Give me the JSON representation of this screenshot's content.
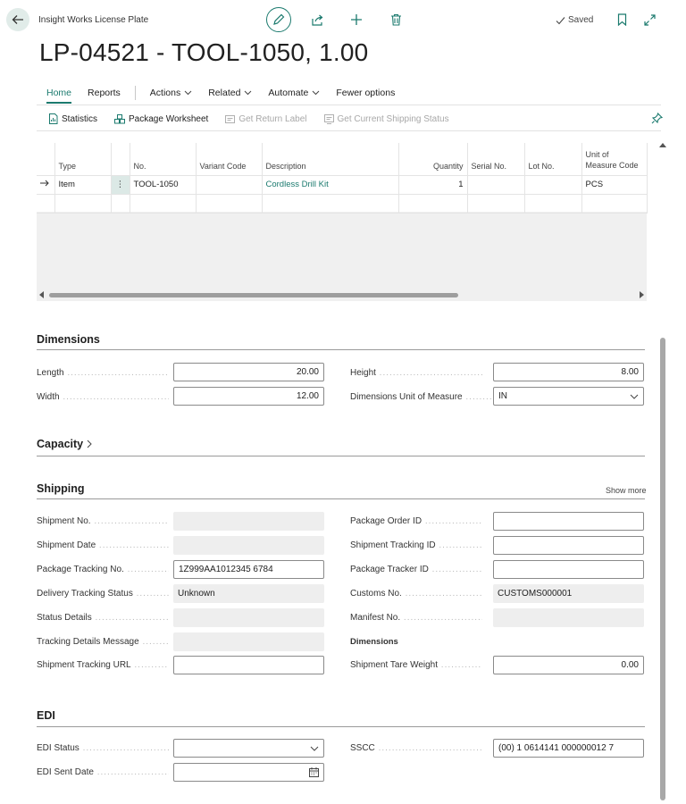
{
  "header": {
    "app_name": "Insight Works License Plate",
    "title": "LP-04521 - TOOL-1050, 1.00",
    "saved": "Saved"
  },
  "nav": {
    "home": "Home",
    "reports": "Reports",
    "actions": "Actions",
    "related": "Related",
    "automate": "Automate",
    "fewer": "Fewer options"
  },
  "toolbar": {
    "statistics": "Statistics",
    "package_worksheet": "Package Worksheet",
    "get_return_label": "Get Return Label",
    "get_shipping_status": "Get Current Shipping Status"
  },
  "lines": {
    "headers": {
      "type": "Type",
      "no": "No.",
      "variant": "Variant Code",
      "description": "Description",
      "quantity": "Quantity",
      "serial": "Serial No.",
      "lot": "Lot No.",
      "uom_1": "Unit of",
      "uom_2": "Measure Code"
    },
    "rows": [
      {
        "type": "Item",
        "no": "TOOL-1050",
        "variant": "",
        "description": "Cordless Drill Kit",
        "quantity": "1",
        "serial": "",
        "lot": "",
        "uom": "PCS"
      }
    ]
  },
  "dimensions": {
    "title": "Dimensions",
    "length_label": "Length",
    "length": "20.00",
    "width_label": "Width",
    "width": "12.00",
    "height_label": "Height",
    "height": "8.00",
    "uom_label": "Dimensions Unit of Measure",
    "uom": "IN"
  },
  "capacity": {
    "title": "Capacity"
  },
  "shipping": {
    "title": "Shipping",
    "show_more": "Show more",
    "shipment_no_label": "Shipment No.",
    "shipment_no": "",
    "shipment_date_label": "Shipment Date",
    "shipment_date": "",
    "package_tracking_label": "Package Tracking No.",
    "package_tracking": "1Z999AA1012345 6784",
    "delivery_status_label": "Delivery Tracking Status",
    "delivery_status": "Unknown",
    "status_details_label": "Status Details",
    "status_details": "",
    "tracking_msg_label": "Tracking Details Message",
    "tracking_msg": "",
    "tracking_url_label": "Shipment Tracking URL",
    "tracking_url": "",
    "package_order_label": "Package Order ID",
    "package_order": "",
    "shipment_tracking_id_label": "Shipment Tracking ID",
    "shipment_tracking_id": "",
    "package_tracker_label": "Package Tracker ID",
    "package_tracker": "",
    "customs_label": "Customs No.",
    "customs": "CUSTOMS000001",
    "manifest_label": "Manifest No.",
    "manifest": "",
    "dimensions_sub": "Dimensions",
    "tare_label": "Shipment Tare Weight",
    "tare": "0.00"
  },
  "edi": {
    "title": "EDI",
    "status_label": "EDI Status",
    "status": "",
    "sent_date_label": "EDI Sent Date",
    "sent_date": "",
    "sscc_label": "SSCC",
    "sscc": "(00) 1 0614141 000000012 7"
  },
  "colors": {
    "accent": "#1b7a6e",
    "back_bg": "#e1ece9"
  }
}
